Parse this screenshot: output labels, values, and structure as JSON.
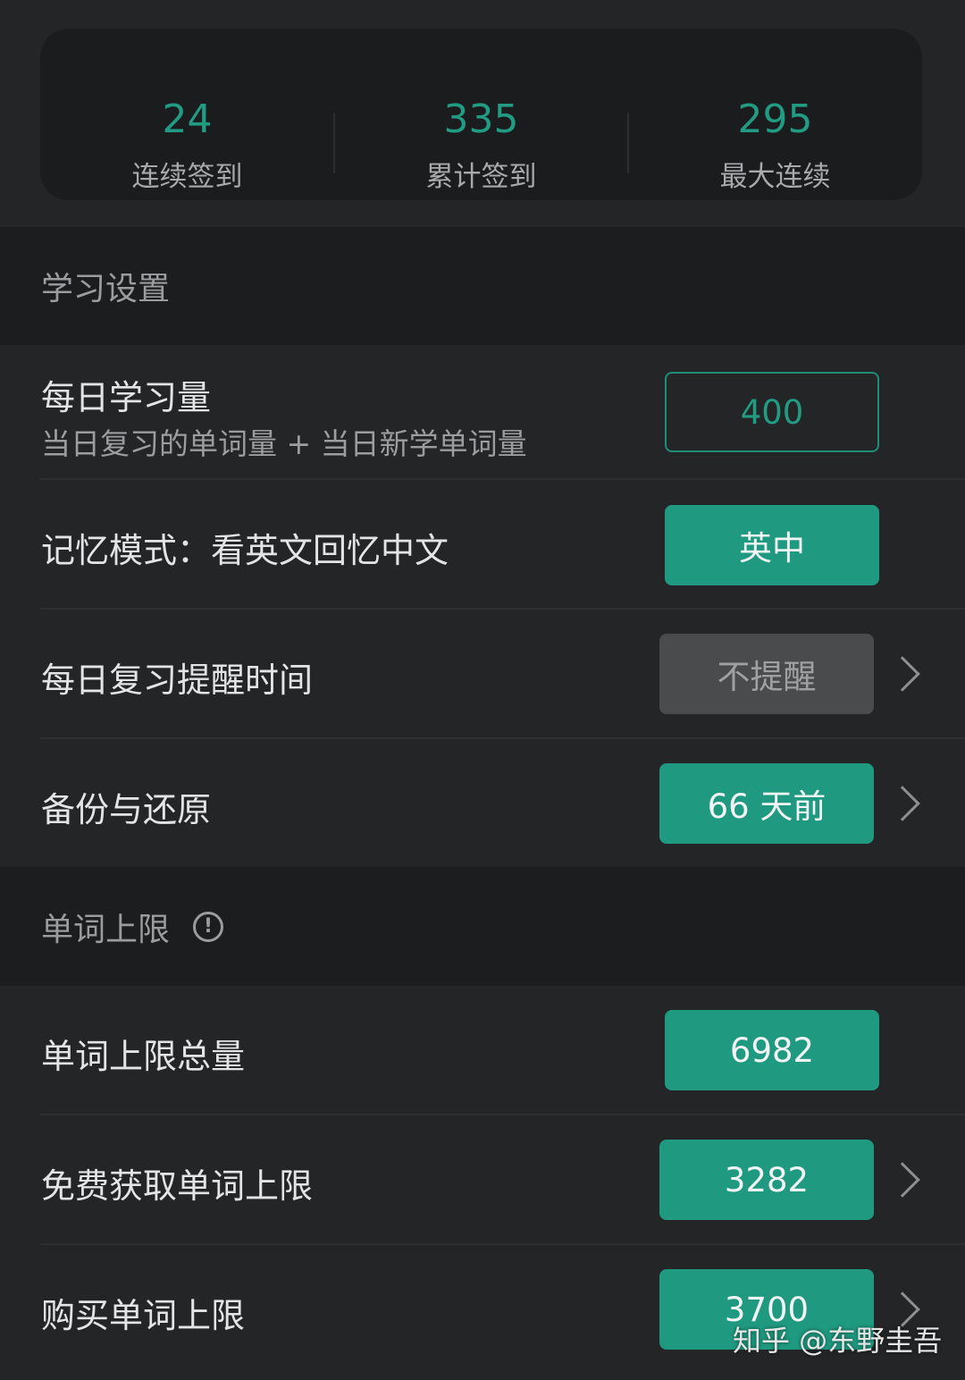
{
  "stats": [
    {
      "value": "24",
      "label": "连续签到"
    },
    {
      "value": "335",
      "label": "累计签到"
    },
    {
      "value": "295",
      "label": "最大连续"
    }
  ],
  "study_section": {
    "title": "学习设置",
    "daily_amount": {
      "title": "每日学习量",
      "subtitle": "当日复习的单词量 + 当日新学单词量",
      "value": "400"
    },
    "memory_mode": {
      "title": "记忆模式：看英文回忆中文",
      "value": "英中"
    },
    "review_reminder": {
      "title": "每日复习提醒时间",
      "value": "不提醒"
    },
    "backup": {
      "title": "备份与还原",
      "value": "66 天前"
    }
  },
  "word_limit_section": {
    "title": "单词上限",
    "info_icon": "!",
    "total": {
      "title": "单词上限总量",
      "value": "6982"
    },
    "free": {
      "title": "免费获取单词上限",
      "value": "3282"
    },
    "buy": {
      "title": "购买单词上限",
      "value": "3700"
    }
  },
  "watermark": "知乎 @东野圭吾",
  "colors": {
    "accent": "#1f9a80",
    "background": "#1c1d1f",
    "panel": "#242527"
  }
}
